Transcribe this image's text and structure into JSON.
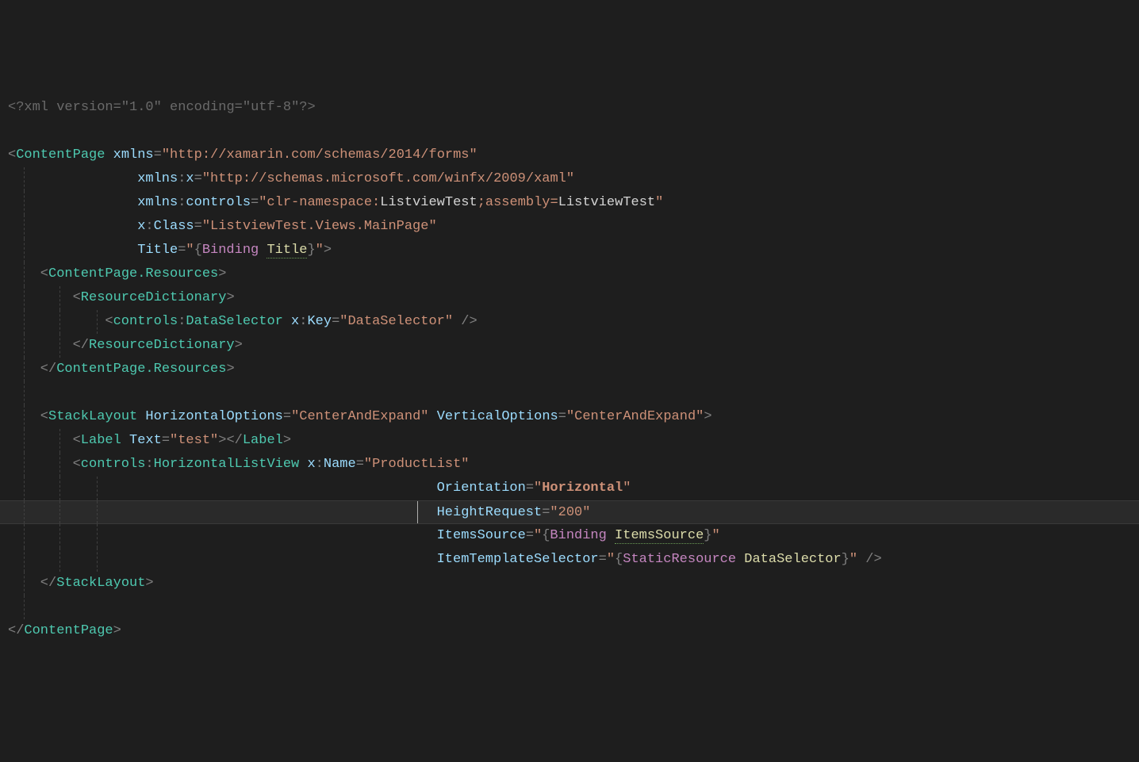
{
  "lines": [
    {
      "indent": 0,
      "guides": [],
      "dim": true,
      "parts": [
        {
          "t": "<?",
          "c": "dim"
        },
        {
          "t": "xml version",
          "c": "dim"
        },
        {
          "t": "=",
          "c": "dim"
        },
        {
          "t": "\"1.0\"",
          "c": "dim"
        },
        {
          "t": " encoding",
          "c": "dim"
        },
        {
          "t": "=",
          "c": "dim"
        },
        {
          "t": "\"utf-8\"",
          "c": "dim"
        },
        {
          "t": "?>",
          "c": "dim"
        }
      ]
    },
    {
      "indent": 0,
      "guides": [],
      "parts": []
    },
    {
      "indent": 0,
      "guides": [],
      "parts": [
        {
          "t": "<",
          "c": "punct"
        },
        {
          "t": "ContentPage",
          "c": "elem"
        },
        {
          "t": " ",
          "c": ""
        },
        {
          "t": "xmlns",
          "c": "attr"
        },
        {
          "t": "=",
          "c": "punct"
        },
        {
          "t": "\"http://xamarin.com/schemas/2014/forms\"",
          "c": "str"
        }
      ]
    },
    {
      "indent": 16,
      "guides": [
        1
      ],
      "parts": [
        {
          "t": "xmlns",
          "c": "attr"
        },
        {
          "t": ":",
          "c": "punct"
        },
        {
          "t": "x",
          "c": "attr"
        },
        {
          "t": "=",
          "c": "punct"
        },
        {
          "t": "\"http://schemas.microsoft.com/winfx/2009/xaml\"",
          "c": "str"
        }
      ]
    },
    {
      "indent": 16,
      "guides": [
        1
      ],
      "parts": [
        {
          "t": "xmlns",
          "c": "attr"
        },
        {
          "t": ":",
          "c": "punct"
        },
        {
          "t": "controls",
          "c": "attr"
        },
        {
          "t": "=",
          "c": "punct"
        },
        {
          "t": "\"clr-namespace:",
          "c": "str"
        },
        {
          "t": "ListviewTest",
          "c": "str-white"
        },
        {
          "t": ";assembly=",
          "c": "str"
        },
        {
          "t": "ListviewTest",
          "c": "str-white"
        },
        {
          "t": "\"",
          "c": "str"
        }
      ]
    },
    {
      "indent": 16,
      "guides": [
        1
      ],
      "parts": [
        {
          "t": "x",
          "c": "attr"
        },
        {
          "t": ":",
          "c": "punct"
        },
        {
          "t": "Class",
          "c": "attr"
        },
        {
          "t": "=",
          "c": "punct"
        },
        {
          "t": "\"ListviewTest.Views.MainPage\"",
          "c": "str"
        }
      ]
    },
    {
      "indent": 16,
      "guides": [
        1
      ],
      "parts": [
        {
          "t": "Title",
          "c": "attr"
        },
        {
          "t": "=",
          "c": "punct"
        },
        {
          "t": "\"",
          "c": "str"
        },
        {
          "t": "{",
          "c": "punct"
        },
        {
          "t": "Binding",
          "c": "keyword"
        },
        {
          "t": " ",
          "c": ""
        },
        {
          "t": "Title",
          "c": "binding",
          "u": true
        },
        {
          "t": "}",
          "c": "punct"
        },
        {
          "t": "\"",
          "c": "str"
        },
        {
          "t": ">",
          "c": "punct"
        }
      ]
    },
    {
      "indent": 4,
      "guides": [
        1
      ],
      "parts": [
        {
          "t": "<",
          "c": "punct"
        },
        {
          "t": "ContentPage.Resources",
          "c": "elem"
        },
        {
          "t": ">",
          "c": "punct"
        }
      ]
    },
    {
      "indent": 8,
      "guides": [
        1,
        2
      ],
      "parts": [
        {
          "t": "<",
          "c": "punct"
        },
        {
          "t": "ResourceDictionary",
          "c": "elem"
        },
        {
          "t": ">",
          "c": "punct"
        }
      ]
    },
    {
      "indent": 12,
      "guides": [
        1,
        2,
        3
      ],
      "parts": [
        {
          "t": "<",
          "c": "punct"
        },
        {
          "t": "controls",
          "c": "elem"
        },
        {
          "t": ":",
          "c": "punct"
        },
        {
          "t": "DataSelector",
          "c": "elem"
        },
        {
          "t": " ",
          "c": ""
        },
        {
          "t": "x",
          "c": "attr"
        },
        {
          "t": ":",
          "c": "punct"
        },
        {
          "t": "Key",
          "c": "attr"
        },
        {
          "t": "=",
          "c": "punct"
        },
        {
          "t": "\"DataSelector\"",
          "c": "str"
        },
        {
          "t": " />",
          "c": "punct"
        }
      ]
    },
    {
      "indent": 8,
      "guides": [
        1,
        2
      ],
      "parts": [
        {
          "t": "</",
          "c": "punct"
        },
        {
          "t": "ResourceDictionary",
          "c": "elem"
        },
        {
          "t": ">",
          "c": "punct"
        }
      ]
    },
    {
      "indent": 4,
      "guides": [
        1
      ],
      "parts": [
        {
          "t": "</",
          "c": "punct"
        },
        {
          "t": "ContentPage.Resources",
          "c": "elem"
        },
        {
          "t": ">",
          "c": "punct"
        }
      ]
    },
    {
      "indent": 0,
      "guides": [
        1
      ],
      "parts": []
    },
    {
      "indent": 4,
      "guides": [
        1
      ],
      "parts": [
        {
          "t": "<",
          "c": "punct"
        },
        {
          "t": "StackLayout",
          "c": "elem"
        },
        {
          "t": " ",
          "c": ""
        },
        {
          "t": "HorizontalOptions",
          "c": "attr"
        },
        {
          "t": "=",
          "c": "punct"
        },
        {
          "t": "\"CenterAndExpand\"",
          "c": "str"
        },
        {
          "t": " ",
          "c": ""
        },
        {
          "t": "VerticalOptions",
          "c": "attr"
        },
        {
          "t": "=",
          "c": "punct"
        },
        {
          "t": "\"CenterAndExpand\"",
          "c": "str"
        },
        {
          "t": ">",
          "c": "punct"
        }
      ]
    },
    {
      "indent": 8,
      "guides": [
        1,
        2
      ],
      "parts": [
        {
          "t": "<",
          "c": "punct"
        },
        {
          "t": "Label",
          "c": "elem"
        },
        {
          "t": " ",
          "c": ""
        },
        {
          "t": "Text",
          "c": "attr"
        },
        {
          "t": "=",
          "c": "punct"
        },
        {
          "t": "\"test\"",
          "c": "str"
        },
        {
          "t": "></",
          "c": "punct"
        },
        {
          "t": "Label",
          "c": "elem"
        },
        {
          "t": ">",
          "c": "punct"
        }
      ]
    },
    {
      "indent": 8,
      "guides": [
        1,
        2
      ],
      "parts": [
        {
          "t": "<",
          "c": "punct"
        },
        {
          "t": "controls",
          "c": "elem"
        },
        {
          "t": ":",
          "c": "punct"
        },
        {
          "t": "HorizontalListView",
          "c": "elem"
        },
        {
          "t": " ",
          "c": ""
        },
        {
          "t": "x",
          "c": "attr"
        },
        {
          "t": ":",
          "c": "punct"
        },
        {
          "t": "Name",
          "c": "attr"
        },
        {
          "t": "=",
          "c": "punct"
        },
        {
          "t": "\"ProductList\"",
          "c": "str"
        }
      ]
    },
    {
      "indent": 53,
      "guides": [
        1,
        2,
        3
      ],
      "parts": [
        {
          "t": "Orientation",
          "c": "attr"
        },
        {
          "t": "=",
          "c": "punct"
        },
        {
          "t": "\"",
          "c": "str"
        },
        {
          "t": "Horizontal",
          "c": "str",
          "b": true
        },
        {
          "t": "\"",
          "c": "str"
        }
      ]
    },
    {
      "indent": 53,
      "guides": [
        1,
        2,
        3
      ],
      "highlighted": true,
      "cursor": true,
      "parts": [
        {
          "t": "HeightRequest",
          "c": "attr"
        },
        {
          "t": "=",
          "c": "punct"
        },
        {
          "t": "\"200\"",
          "c": "str"
        }
      ]
    },
    {
      "indent": 53,
      "guides": [
        1,
        2,
        3
      ],
      "parts": [
        {
          "t": "ItemsSource",
          "c": "attr"
        },
        {
          "t": "=",
          "c": "punct"
        },
        {
          "t": "\"",
          "c": "str"
        },
        {
          "t": "{",
          "c": "punct"
        },
        {
          "t": "Binding",
          "c": "keyword"
        },
        {
          "t": " ",
          "c": ""
        },
        {
          "t": "ItemsSource",
          "c": "binding",
          "u": true
        },
        {
          "t": "}",
          "c": "punct"
        },
        {
          "t": "\"",
          "c": "str"
        }
      ]
    },
    {
      "indent": 53,
      "guides": [
        1,
        2,
        3
      ],
      "parts": [
        {
          "t": "ItemTemplateSelector",
          "c": "attr"
        },
        {
          "t": "=",
          "c": "punct"
        },
        {
          "t": "\"",
          "c": "str"
        },
        {
          "t": "{",
          "c": "punct"
        },
        {
          "t": "StaticResource",
          "c": "keyword"
        },
        {
          "t": " ",
          "c": ""
        },
        {
          "t": "DataSelector",
          "c": "binding"
        },
        {
          "t": "}",
          "c": "punct"
        },
        {
          "t": "\"",
          "c": "str"
        },
        {
          "t": " />",
          "c": "punct"
        }
      ]
    },
    {
      "indent": 4,
      "guides": [
        1
      ],
      "parts": [
        {
          "t": "</",
          "c": "punct"
        },
        {
          "t": "StackLayout",
          "c": "elem"
        },
        {
          "t": ">",
          "c": "punct"
        }
      ]
    },
    {
      "indent": 0,
      "guides": [
        1
      ],
      "parts": []
    },
    {
      "indent": 0,
      "guides": [],
      "parts": [
        {
          "t": "</",
          "c": "punct"
        },
        {
          "t": "ContentPage",
          "c": "elem"
        },
        {
          "t": ">",
          "c": "punct"
        }
      ]
    }
  ],
  "guidePositions": {
    "1": 20,
    "2": 65,
    "3": 112
  },
  "charWidth": 10.2
}
